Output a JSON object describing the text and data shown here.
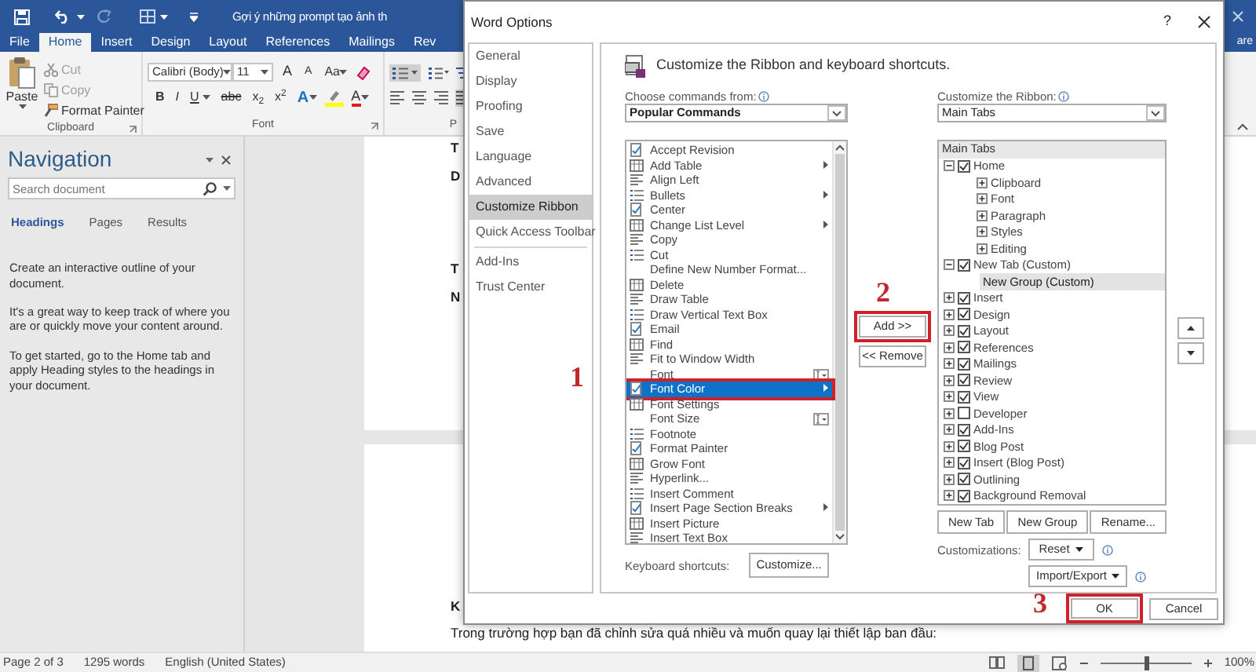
{
  "word": {
    "title": "Gợi ý những prompt tạo ảnh th",
    "tabs": [
      {
        "label": "File",
        "selected": false
      },
      {
        "label": "Home",
        "selected": true
      },
      {
        "label": "Insert",
        "selected": false
      },
      {
        "label": "Design",
        "selected": false
      },
      {
        "label": "Layout",
        "selected": false
      },
      {
        "label": "References",
        "selected": false
      },
      {
        "label": "Mailings",
        "selected": false
      },
      {
        "label": "Rev",
        "selected": false
      }
    ],
    "share": "are",
    "clipboard": {
      "paste": "Paste",
      "actions": [
        {
          "label": "Cut",
          "disabled": true
        },
        {
          "label": "Copy",
          "disabled": true
        },
        {
          "label": "Format Painter",
          "disabled": false
        }
      ],
      "label": "Clipboard"
    },
    "font": {
      "name": "Calibri (Body)",
      "size": "11",
      "grow": "A",
      "shrink": "A",
      "change_case": "Aa",
      "styles": [
        {
          "label": "B",
          "dropdown": false
        },
        {
          "label": "I",
          "dropdown": false
        },
        {
          "label": "U",
          "dropdown": true
        },
        {
          "label": "abc",
          "dropdown": false
        },
        {
          "label": "x$_{2}$",
          "dropdown": false
        },
        {
          "label": "x$^{2}$",
          "dropdown": false
        }
      ],
      "text_effects": "A",
      "font_color": "A",
      "label": "Font"
    },
    "paragraph": {
      "label": "P"
    },
    "navigation": {
      "title": "Navigation",
      "search": {
        "placeholder": "Search document"
      },
      "tabs": [
        {
          "label": "Headings",
          "selected": true
        },
        {
          "label": "Pages",
          "selected": false
        },
        {
          "label": "Results",
          "selected": false
        }
      ],
      "paragraphs": [
        "Create an interactive outline of your document.",
        "It's a great way to keep track of where you are or quickly move your content around.",
        "To get started, go to the Home tab and apply Heading styles to the headings in your document."
      ]
    },
    "pages": [
      {
        "lines": [
          {
            "text": "T",
            "kind": "heading"
          },
          {
            "text": "D",
            "kind": "heading"
          },
          {
            "text": "T",
            "kind": "heading"
          },
          {
            "text": "N",
            "kind": "heading"
          }
        ]
      },
      {
        "lines": [
          {
            "text": "K",
            "kind": "heading"
          },
          {
            "text": "Trong trường hợp bạn đã chỉnh sửa quá nhiều và muốn quay lại thiết lập ban đầu:",
            "kind": "body"
          }
        ]
      }
    ],
    "status_bar": {
      "page": "Page 2 of 3",
      "words": "1295 words",
      "language": "English (United States)",
      "zoom": {
        "level": 0.5
      },
      "zoom_percent": "100%"
    }
  },
  "dialog": {
    "title": "Word Options",
    "help": "?",
    "sections": [
      {
        "items": [
          {
            "label": "General",
            "selected": false
          },
          {
            "label": "Display",
            "selected": false
          },
          {
            "label": "Proofing",
            "selected": false
          },
          {
            "label": "Save",
            "selected": false
          },
          {
            "label": "Language",
            "selected": false
          },
          {
            "label": "Advanced",
            "selected": false
          },
          {
            "label": "Customize Ribbon",
            "selected": true
          },
          {
            "label": "Quick Access Toolbar",
            "selected": false
          }
        ]
      },
      {
        "items": [
          {
            "label": "Add-Ins",
            "selected": false
          },
          {
            "label": "Trust Center",
            "selected": false
          }
        ]
      }
    ],
    "heading": "Customize the Ribbon and keyboard shortcuts.",
    "commands": {
      "label": "Choose commands from:",
      "source": "Popular Commands",
      "callout": "1",
      "items": [
        {
          "label": "Accept Revision",
          "kind": "icon",
          "submenu": false,
          "picker": false,
          "selected": false
        },
        {
          "label": "Add Table",
          "kind": "icon",
          "submenu": true,
          "picker": false,
          "selected": false
        },
        {
          "label": "Align Left",
          "kind": "icon",
          "submenu": false,
          "picker": false,
          "selected": false
        },
        {
          "label": "Bullets",
          "kind": "icon",
          "submenu": true,
          "picker": false,
          "selected": false
        },
        {
          "label": "Center",
          "kind": "icon",
          "submenu": false,
          "picker": false,
          "selected": false
        },
        {
          "label": "Change List Level",
          "kind": "icon",
          "submenu": true,
          "picker": false,
          "selected": false
        },
        {
          "label": "Copy",
          "kind": "icon",
          "submenu": false,
          "picker": false,
          "selected": false
        },
        {
          "label": "Cut",
          "kind": "icon",
          "submenu": false,
          "picker": false,
          "selected": false
        },
        {
          "label": "Define New Number Format...",
          "kind": "plain",
          "submenu": false,
          "picker": false,
          "selected": false
        },
        {
          "label": "Delete",
          "kind": "icon",
          "submenu": false,
          "picker": false,
          "selected": false
        },
        {
          "label": "Draw Table",
          "kind": "icon",
          "submenu": false,
          "picker": false,
          "selected": false
        },
        {
          "label": "Draw Vertical Text Box",
          "kind": "icon",
          "submenu": false,
          "picker": false,
          "selected": false
        },
        {
          "label": "Email",
          "kind": "icon",
          "submenu": false,
          "picker": false,
          "selected": false
        },
        {
          "label": "Find",
          "kind": "icon",
          "submenu": false,
          "picker": false,
          "selected": false
        },
        {
          "label": "Fit to Window Width",
          "kind": "icon",
          "submenu": false,
          "picker": false,
          "selected": false
        },
        {
          "label": "Font",
          "kind": "plain",
          "submenu": false,
          "picker": true,
          "selected": false
        },
        {
          "label": "Font Color",
          "kind": "icon",
          "submenu": true,
          "picker": false,
          "selected": true
        },
        {
          "label": "Font Settings",
          "kind": "icon",
          "submenu": false,
          "picker": false,
          "selected": false
        },
        {
          "label": "Font Size",
          "kind": "plain",
          "submenu": false,
          "picker": true,
          "selected": false
        },
        {
          "label": "Footnote",
          "kind": "icon",
          "submenu": false,
          "picker": false,
          "selected": false
        },
        {
          "label": "Format Painter",
          "kind": "icon",
          "submenu": false,
          "picker": false,
          "selected": false
        },
        {
          "label": "Grow Font",
          "kind": "icon",
          "submenu": false,
          "picker": false,
          "selected": false
        },
        {
          "label": "Hyperlink...",
          "kind": "icon",
          "submenu": false,
          "picker": false,
          "selected": false
        },
        {
          "label": "Insert Comment",
          "kind": "icon",
          "submenu": false,
          "picker": false,
          "selected": false
        },
        {
          "label": "Insert Page  Section Breaks",
          "kind": "icon",
          "submenu": true,
          "picker": false,
          "selected": false
        },
        {
          "label": "Insert Picture",
          "kind": "icon",
          "submenu": false,
          "picker": false,
          "selected": false
        },
        {
          "label": "Insert Text Box",
          "kind": "icon",
          "submenu": false,
          "picker": false,
          "selected": false
        }
      ],
      "shortcuts_label": "Keyboard shortcuts:",
      "customize": "Customize..."
    },
    "add": {
      "label": "Add >>",
      "callout": "2"
    },
    "remove": "<< Remove",
    "ribbon": {
      "label": "Customize the Ribbon:",
      "source": "Main Tabs",
      "header": "Main Tabs",
      "nodes": [
        {
          "label": "Home",
          "kind": "tab",
          "checked": true,
          "expanded": true,
          "selected": false,
          "children": [
            {
              "label": "Clipboard",
              "kind": "group",
              "expanded": false,
              "selected": false
            },
            {
              "label": "Font",
              "kind": "group",
              "expanded": false,
              "selected": false
            },
            {
              "label": "Paragraph",
              "kind": "group",
              "expanded": false,
              "selected": false
            },
            {
              "label": "Styles",
              "kind": "group",
              "expanded": false,
              "selected": false
            },
            {
              "label": "Editing",
              "kind": "group",
              "expanded": false,
              "selected": false
            }
          ]
        },
        {
          "label": "New Tab (Custom)",
          "kind": "tab",
          "checked": true,
          "expanded": true,
          "selected": false,
          "children": [
            {
              "label": "New Group (Custom)",
              "kind": "custom-group",
              "selected": true
            }
          ]
        },
        {
          "label": "Insert",
          "kind": "tab",
          "checked": true,
          "expanded": false,
          "selected": false
        },
        {
          "label": "Design",
          "kind": "tab",
          "checked": true,
          "expanded": false,
          "selected": false
        },
        {
          "label": "Layout",
          "kind": "tab",
          "checked": true,
          "expanded": false,
          "selected": false
        },
        {
          "label": "References",
          "kind": "tab",
          "checked": true,
          "expanded": false,
          "selected": false
        },
        {
          "label": "Mailings",
          "kind": "tab",
          "checked": true,
          "expanded": false,
          "selected": false
        },
        {
          "label": "Review",
          "kind": "tab",
          "checked": true,
          "expanded": false,
          "selected": false
        },
        {
          "label": "View",
          "kind": "tab",
          "checked": true,
          "expanded": false,
          "selected": false
        },
        {
          "label": "Developer",
          "kind": "tab",
          "checked": false,
          "expanded": false,
          "selected": false
        },
        {
          "label": "Add-Ins",
          "kind": "tab",
          "checked": true,
          "expanded": false,
          "selected": false
        },
        {
          "label": "Blog Post",
          "kind": "tab",
          "checked": true,
          "expanded": false,
          "selected": false
        },
        {
          "label": "Insert (Blog Post)",
          "kind": "tab",
          "checked": true,
          "expanded": false,
          "selected": false
        },
        {
          "label": "Outlining",
          "kind": "tab",
          "checked": true,
          "expanded": false,
          "selected": false
        },
        {
          "label": "Background Removal",
          "kind": "tab",
          "checked": true,
          "expanded": false,
          "selected": false
        }
      ],
      "buttons": [
        "New Tab",
        "New Group",
        "Rename..."
      ],
      "customizations_label": "Customizations:",
      "reset": "Reset",
      "import_export": "Import/Export"
    },
    "ok": {
      "label": "OK",
      "callout": "3"
    },
    "cancel": "Cancel"
  }
}
